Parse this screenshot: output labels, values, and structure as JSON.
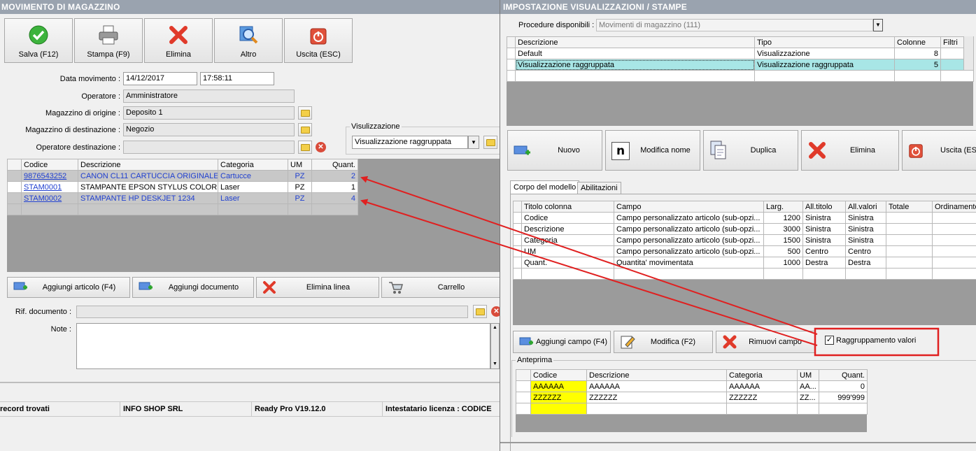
{
  "left": {
    "title": "MOVIMENTO DI MAGAZZINO",
    "toolbar": [
      {
        "label": "Salva (F12)",
        "icon": "check-icon"
      },
      {
        "label": "Stampa (F9)",
        "icon": "printer-icon"
      },
      {
        "label": "Elimina",
        "icon": "delete-x-icon"
      },
      {
        "label": "Altro",
        "icon": "magnifier-icon"
      },
      {
        "label": "Uscita (ESC)",
        "icon": "power-icon"
      }
    ],
    "form": {
      "data_label": "Data movimento :",
      "data_value": "14/12/2017",
      "ora_value": "17:58:11",
      "operatore_label": "Operatore :",
      "operatore_value": "Amministratore",
      "origine_label": "Magazzino di origine :",
      "origine_value": "Deposito 1",
      "destinazione_label": "Magazzino di destinazione :",
      "destinazione_value": "Negozio",
      "op_dest_label": "Operatore destinazione :",
      "op_dest_value": ""
    },
    "visualizzazione": {
      "group_label": "Visulizzazione",
      "selected": "Visualizzazione raggruppata"
    },
    "grid": {
      "headers": [
        "Codice",
        "Descrizione",
        "Categoria",
        "UM",
        "Quant."
      ],
      "rows": [
        {
          "codice": "9876543252",
          "descrizione": "CANON CL11 CARTUCCIA ORIGINALE",
          "categoria": "Cartucce",
          "um": "PZ",
          "quant": "2"
        },
        {
          "codice": "STAM0001",
          "descrizione": "STAMPANTE EPSON STYLUS COLOR C...",
          "categoria": "Laser",
          "um": "PZ",
          "quant": "1"
        },
        {
          "codice": "STAM0002",
          "descrizione": "STAMPANTE HP DESKJET 1234",
          "categoria": "Laser",
          "um": "PZ",
          "quant": "4"
        }
      ]
    },
    "row_buttons": [
      {
        "label": "Aggiungi articolo (F4)"
      },
      {
        "label": "Aggiungi documento"
      },
      {
        "label": "Elimina linea"
      },
      {
        "label": "Carrello"
      }
    ],
    "rif_label": "Rif. documento :",
    "note_label": "Note :",
    "status": [
      "record trovati",
      "INFO SHOP SRL",
      "Ready Pro V19.12.0",
      "Intestatario licenza : CODICE"
    ]
  },
  "right": {
    "title": "IMPOSTAZIONE VISUALIZZAZIONI / STAMPE",
    "procedure_label": "Procedure disponibili :",
    "procedure_value": "Movimenti di magazzino (111)",
    "views_grid": {
      "headers": [
        "Descrizione",
        "Tipo",
        "Colonne",
        "Filtri"
      ],
      "rows": [
        {
          "descrizione": "Default",
          "tipo": "Visualizzazione",
          "colonne": "8"
        },
        {
          "descrizione": "Visualizzazione raggruppata",
          "tipo": "Visualizzazione raggruppata",
          "colonne": "5"
        }
      ]
    },
    "buttons": [
      {
        "label": "Nuovo"
      },
      {
        "label": "Modifica nome"
      },
      {
        "label": "Duplica"
      },
      {
        "label": "Elimina"
      },
      {
        "label": "Uscita (ES"
      }
    ],
    "tabs": [
      "Corpo del modello",
      "Abilitazioni"
    ],
    "fields_grid": {
      "headers": [
        "Titolo colonna",
        "Campo",
        "Larg.",
        "All.titolo",
        "All.valori",
        "Totale",
        "Ordinamento"
      ],
      "rows": [
        {
          "titolo": "Codice",
          "campo": "Campo personalizzato articolo (sub-opzi...",
          "larg": "1200",
          "all_titolo": "Sinistra",
          "all_valori": "Sinistra"
        },
        {
          "titolo": "Descrizione",
          "campo": "Campo personalizzato articolo (sub-opzi...",
          "larg": "3000",
          "all_titolo": "Sinistra",
          "all_valori": "Sinistra"
        },
        {
          "titolo": "Categoria",
          "campo": "Campo personalizzato articolo (sub-opzi...",
          "larg": "1500",
          "all_titolo": "Sinistra",
          "all_valori": "Sinistra"
        },
        {
          "titolo": "UM",
          "campo": "Campo personalizzato articolo (sub-opzi...",
          "larg": "500",
          "all_titolo": "Centro",
          "all_valori": "Centro"
        },
        {
          "titolo": "Quant.",
          "campo": "Quantita' movimentata",
          "larg": "1000",
          "all_titolo": "Destra",
          "all_valori": "Destra"
        }
      ]
    },
    "field_buttons": [
      {
        "label": "Aggiungi campo (F4)"
      },
      {
        "label": "Modifica (F2)"
      },
      {
        "label": "Rimuovi campo"
      }
    ],
    "raggruppamento_label": "Raggruppamento valori",
    "anteprima": {
      "label": "Anteprima",
      "headers": [
        "Codice",
        "Descrizione",
        "Categoria",
        "UM",
        "Quant."
      ],
      "rows": [
        {
          "codice": "AAAAAA",
          "descrizione": "AAAAAA",
          "categoria": "AAAAAA",
          "um": "AA...",
          "quant": "0"
        },
        {
          "codice": "ZZZZZZ",
          "descrizione": "ZZZZZZ",
          "categoria": "ZZZZZZ",
          "um": "ZZ...",
          "quant": "999'999"
        }
      ]
    }
  },
  "colors": {
    "annotation": "#e02020",
    "title_bar": "#9aa3af",
    "highlight_row": "#a8e6e6",
    "preview_yellow": "#ffff00"
  }
}
